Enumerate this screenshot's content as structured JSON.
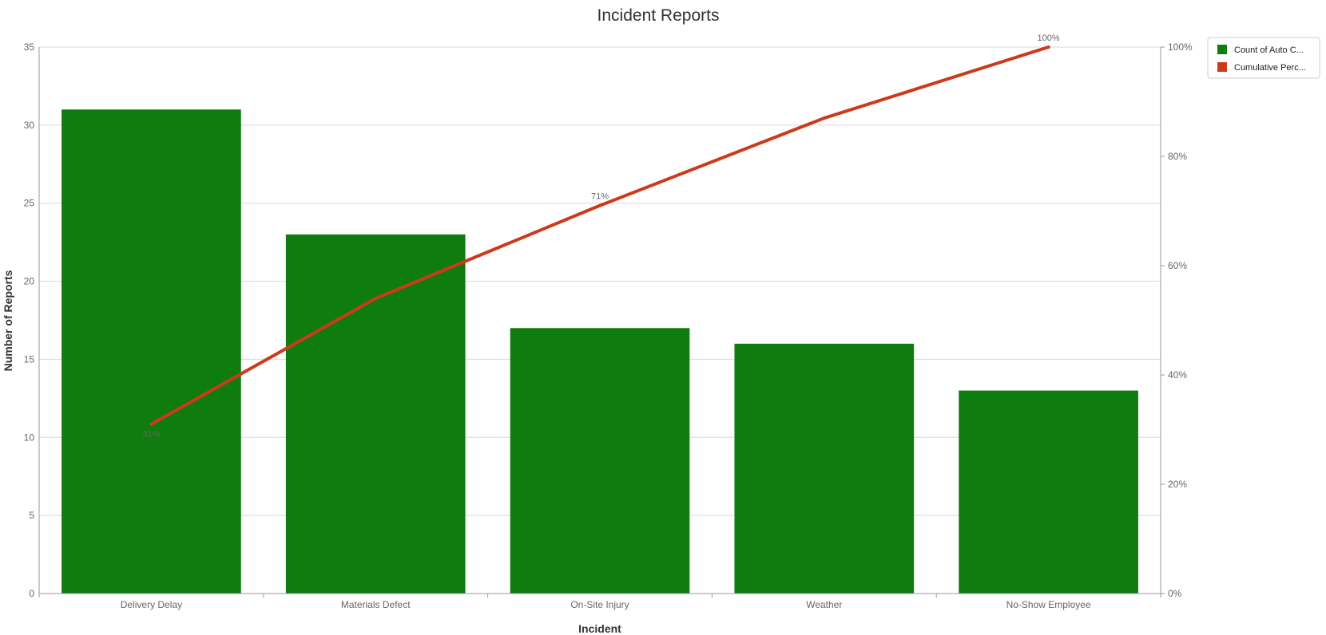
{
  "chart_data": {
    "type": "bar",
    "title": "Incident Reports",
    "xlabel": "Incident",
    "ylabel": "Number of Reports",
    "categories": [
      "Delivery Delay",
      "Materials Defect",
      "On-Site Injury",
      "Weather",
      "No-Show Employee"
    ],
    "series": [
      {
        "name": "Count of Auto C...",
        "type": "bar",
        "axis": "left",
        "values": [
          31,
          23,
          17,
          16,
          13
        ],
        "color": "#0e7c0e"
      },
      {
        "name": "Cumulative Perc...",
        "type": "line",
        "axis": "right",
        "values": [
          31,
          54,
          71,
          87,
          100
        ],
        "color": "#cc3a1a"
      }
    ],
    "y_left": {
      "min": 0,
      "max": 35,
      "ticks": [
        "0",
        "5",
        "10",
        "15",
        "20",
        "25",
        "30",
        "35"
      ]
    },
    "y_right": {
      "min": 0,
      "max": 100,
      "ticks": [
        "0%",
        "20%",
        "40%",
        "60%",
        "80%",
        "100%"
      ]
    },
    "data_labels": [
      {
        "index": 0,
        "text": "31%"
      },
      {
        "index": 2,
        "text": "71%"
      },
      {
        "index": 4,
        "text": "100%"
      }
    ],
    "grid": true,
    "legend_position": "top-right"
  }
}
